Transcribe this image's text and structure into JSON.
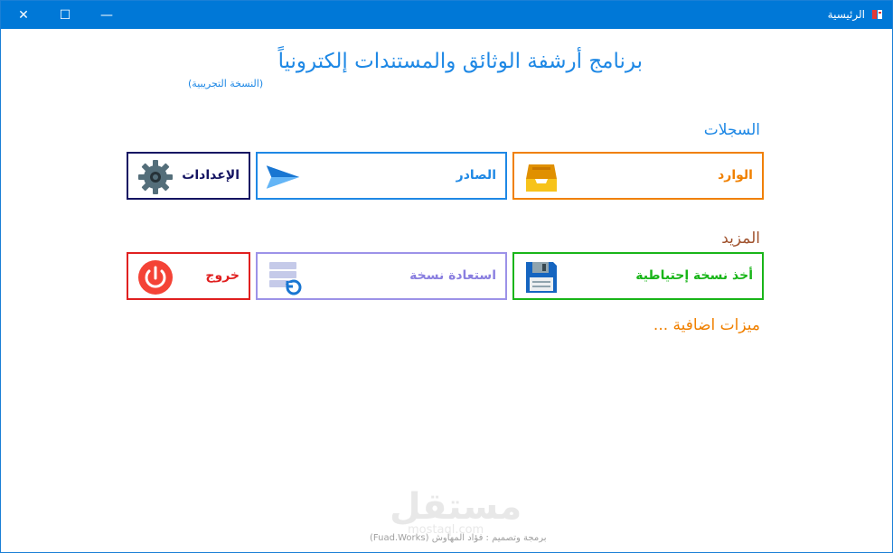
{
  "window": {
    "title": "الرئيسية",
    "controls": {
      "close": "✕",
      "maximize": "☐",
      "minimize": "—"
    }
  },
  "header": {
    "title": "برنامج أرشفة الوثائق والمستندات إلكترونياً",
    "edition": "(النسخة التجريبية)"
  },
  "sections": {
    "records": "السجلات",
    "more": "المزيد",
    "extra": "ميزات اضافية ..."
  },
  "tiles": {
    "inbox": {
      "label": "الوارد",
      "icon": "inbox-tray-icon"
    },
    "outbox": {
      "label": "الصادر",
      "icon": "paper-plane-icon"
    },
    "settings": {
      "label": "الإعدادات",
      "icon": "gear-icon"
    },
    "backup": {
      "label": "أخذ نسخة إحتياطية",
      "icon": "floppy-disk-icon"
    },
    "restore": {
      "label": "استعادة نسخة",
      "icon": "database-restore-icon"
    },
    "exit": {
      "label": "خروج",
      "icon": "power-icon"
    }
  },
  "footer": {
    "watermark": "مستقل",
    "watermark_sub": "mostaql.com",
    "credit": "برمجة وتصميم : فؤاد المهاوش (Fuad.Works)"
  },
  "colors": {
    "titlebar": "#0078d7",
    "primary": "#1e88e5",
    "inbox": "#f08000",
    "settings": "#141462",
    "backup": "#19b519",
    "restore": "#9c92e8",
    "exit": "#e02020"
  }
}
